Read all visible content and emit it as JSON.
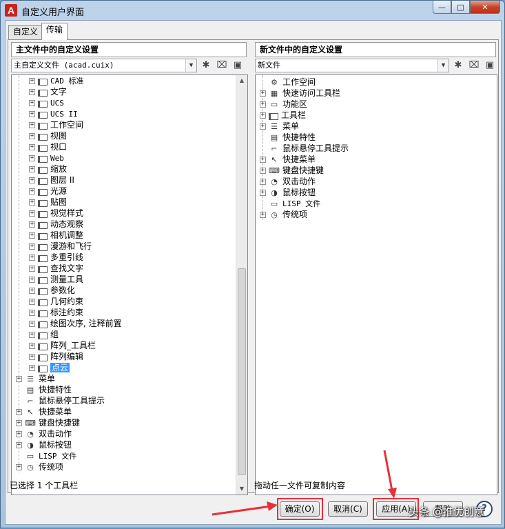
{
  "window": {
    "title": "自定义用户界面",
    "buttons": [
      "—",
      "□",
      "✕"
    ]
  },
  "tabs": [
    {
      "label": "自定义",
      "active": false
    },
    {
      "label": "传输",
      "active": true
    }
  ],
  "left_pane": {
    "header": "主文件中的自定义设置",
    "combo_value": "主自定义文件 (acad.cuix)",
    "items": [
      {
        "label": "CAD 标准",
        "level": 2,
        "icon": "toolbar-icon",
        "expander": "+"
      },
      {
        "label": "文字",
        "level": 2,
        "icon": "toolbar-icon",
        "expander": "+"
      },
      {
        "label": "UCS",
        "level": 2,
        "icon": "toolbar-icon",
        "expander": "+"
      },
      {
        "label": "UCS II",
        "level": 2,
        "icon": "toolbar-icon",
        "expander": "+"
      },
      {
        "label": "工作空间",
        "level": 2,
        "icon": "toolbar-icon",
        "expander": "+"
      },
      {
        "label": "视图",
        "level": 2,
        "icon": "toolbar-icon",
        "expander": "+"
      },
      {
        "label": "视口",
        "level": 2,
        "icon": "toolbar-icon",
        "expander": "+"
      },
      {
        "label": "Web",
        "level": 2,
        "icon": "toolbar-icon",
        "expander": "+"
      },
      {
        "label": "缩放",
        "level": 2,
        "icon": "toolbar-icon",
        "expander": "+"
      },
      {
        "label": "图层 II",
        "level": 2,
        "icon": "toolbar-icon",
        "expander": "+"
      },
      {
        "label": "光源",
        "level": 2,
        "icon": "toolbar-icon",
        "expander": "+"
      },
      {
        "label": "贴图",
        "level": 2,
        "icon": "toolbar-icon",
        "expander": "+"
      },
      {
        "label": "视觉样式",
        "level": 2,
        "icon": "toolbar-icon",
        "expander": "+"
      },
      {
        "label": "动态观察",
        "level": 2,
        "icon": "toolbar-icon",
        "expander": "+"
      },
      {
        "label": "相机调整",
        "level": 2,
        "icon": "toolbar-icon",
        "expander": "+"
      },
      {
        "label": "漫游和飞行",
        "level": 2,
        "icon": "toolbar-icon",
        "expander": "+"
      },
      {
        "label": "多重引线",
        "level": 2,
        "icon": "toolbar-icon",
        "expander": "+"
      },
      {
        "label": "查找文字",
        "level": 2,
        "icon": "toolbar-icon",
        "expander": "+"
      },
      {
        "label": "测量工具",
        "level": 2,
        "icon": "toolbar-icon",
        "expander": "+"
      },
      {
        "label": "参数化",
        "level": 2,
        "icon": "toolbar-icon",
        "expander": "+"
      },
      {
        "label": "几何约束",
        "level": 2,
        "icon": "toolbar-icon",
        "expander": "+"
      },
      {
        "label": "标注约束",
        "level": 2,
        "icon": "toolbar-icon",
        "expander": "+"
      },
      {
        "label": "绘图次序, 注释前置",
        "level": 2,
        "icon": "toolbar-icon",
        "expander": "+"
      },
      {
        "label": "组",
        "level": 2,
        "icon": "toolbar-icon",
        "expander": "+"
      },
      {
        "label": "阵列_工具栏",
        "level": 2,
        "icon": "toolbar-icon",
        "expander": "+"
      },
      {
        "label": "阵列编辑",
        "level": 2,
        "icon": "toolbar-icon",
        "expander": "+"
      },
      {
        "label": "点云",
        "level": 2,
        "icon": "toolbar-icon",
        "expander": "+",
        "selected": true
      },
      {
        "label": "菜单",
        "level": 1,
        "icon": "menu-icon",
        "expander": "+"
      },
      {
        "label": "快捷特性",
        "level": 1,
        "icon": "quick-properties-icon",
        "expander": ""
      },
      {
        "label": "鼠标悬停工具提示",
        "level": 1,
        "icon": "rollover-tooltip-icon",
        "expander": ""
      },
      {
        "label": "快捷菜单",
        "level": 1,
        "icon": "shortcut-menu-icon",
        "expander": "+"
      },
      {
        "label": "键盘快捷键",
        "level": 1,
        "icon": "keyboard-shortcut-icon",
        "expander": "+"
      },
      {
        "label": "双击动作",
        "level": 1,
        "icon": "double-click-icon",
        "expander": "+"
      },
      {
        "label": "鼠标按钮",
        "level": 1,
        "icon": "mouse-button-icon",
        "expander": "+"
      },
      {
        "label": "LISP 文件",
        "level": 1,
        "icon": "lisp-file-icon",
        "expander": ""
      },
      {
        "label": "传统项",
        "level": 1,
        "icon": "legacy-icon",
        "expander": "+"
      }
    ]
  },
  "right_pane": {
    "header": "新文件中的自定义设置",
    "combo_value": "新文件",
    "items": [
      {
        "label": "工作空间",
        "icon": "workspace-icon",
        "expander": ""
      },
      {
        "label": "快速访问工具栏",
        "icon": "quick-access-toolbar-icon",
        "expander": "+"
      },
      {
        "label": "功能区",
        "icon": "ribbon-icon",
        "expander": "+"
      },
      {
        "label": "工具栏",
        "icon": "toolbar-icon",
        "expander": "+"
      },
      {
        "label": "菜单",
        "icon": "menu-icon",
        "expander": "+"
      },
      {
        "label": "快捷特性",
        "icon": "quick-properties-icon",
        "expander": ""
      },
      {
        "label": "鼠标悬停工具提示",
        "icon": "rollover-tooltip-icon",
        "expander": ""
      },
      {
        "label": "快捷菜单",
        "icon": "shortcut-menu-icon",
        "expander": "+"
      },
      {
        "label": "键盘快捷键",
        "icon": "keyboard-shortcut-icon",
        "expander": "+"
      },
      {
        "label": "双击动作",
        "icon": "double-click-icon",
        "expander": "+"
      },
      {
        "label": "鼠标按钮",
        "icon": "mouse-button-icon",
        "expander": "+"
      },
      {
        "label": "LISP 文件",
        "icon": "lisp-file-icon",
        "expander": ""
      },
      {
        "label": "传统项",
        "icon": "legacy-icon",
        "expander": "+"
      }
    ]
  },
  "status": {
    "left": "已选择 1 个工具栏",
    "right": "拖动任一文件可复制内容"
  },
  "footer": {
    "ok": "确定(O)",
    "cancel": "取消(C)",
    "apply": "应用(A)",
    "help": "帮助"
  },
  "watermark": "头条 @推优创意",
  "colors": {
    "highlight": "#e8303a",
    "selection": "#3399ff"
  }
}
